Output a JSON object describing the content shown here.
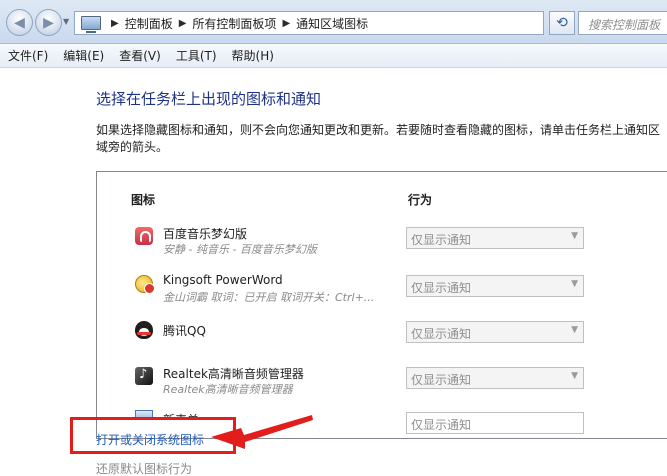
{
  "address_bar": {
    "breadcrumbs": [
      "控制面板",
      "所有控制面板项",
      "通知区域图标"
    ],
    "search_placeholder": "搜索控制面板"
  },
  "menu": {
    "items": [
      "文件(F)",
      "编辑(E)",
      "查看(V)",
      "工具(T)",
      "帮助(H)"
    ]
  },
  "main": {
    "title": "选择在任务栏上出现的图标和通知",
    "description": "如果选择隐藏图标和通知，则不会向您通知更改和更新。若要随时查看隐藏的图标，请单击任务栏上通知区域旁的箭头。",
    "columns": {
      "icon": "图标",
      "behavior": "行为"
    },
    "rows": [
      {
        "name": "百度音乐梦幻版",
        "subtitle": "安静 - 纯音乐 - 百度音乐梦幻版",
        "behavior": "仅显示通知",
        "icon": "baidu-music-icon"
      },
      {
        "name": "Kingsoft PowerWord",
        "subtitle": "金山词霸 取词：已开启 取词开关：Ctrl+...",
        "behavior": "仅显示通知",
        "icon": "kingsoft-powerword-icon"
      },
      {
        "name": "腾讯QQ",
        "subtitle": "",
        "behavior": "仅显示通知",
        "icon": "qq-penguin-icon"
      },
      {
        "name": "Realtek高清晰音频管理器",
        "subtitle": "Realtek高清晰音频管理器",
        "behavior": "仅显示通知",
        "icon": "realtek-audio-icon"
      },
      {
        "name": "新表单",
        "subtitle": "",
        "behavior": "仅显示通知",
        "icon": "generic-app-icon"
      }
    ],
    "links": {
      "system_icons": "打开或关闭系统图标",
      "restore_defaults": "还原默认图标行为"
    }
  },
  "annotation": {
    "highlight_color": "#e31c1c"
  },
  "colors": {
    "title": "#1e3287",
    "link": "#1f5bba"
  }
}
